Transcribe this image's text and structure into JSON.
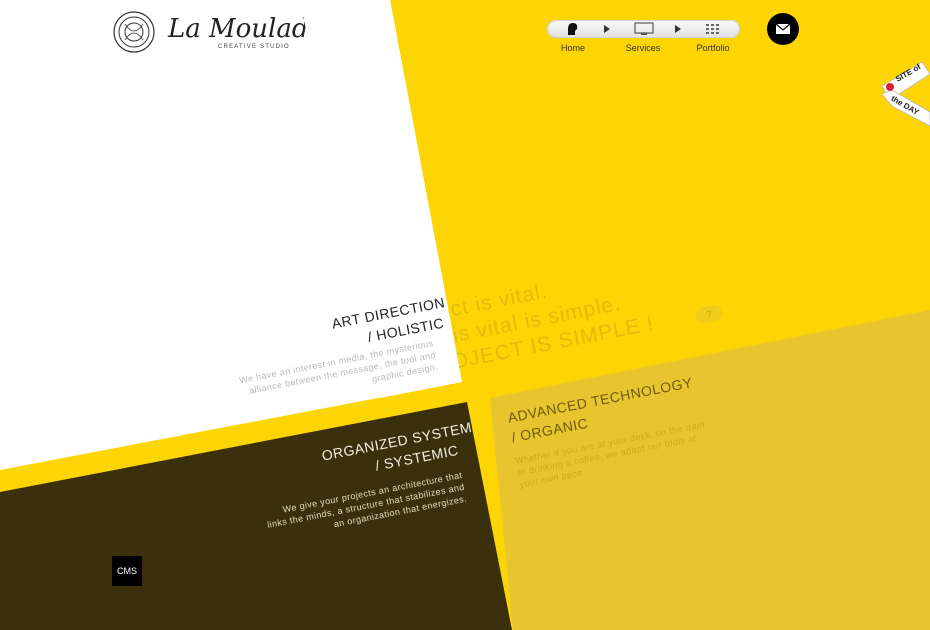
{
  "brand": {
    "name": "La Moulade",
    "subtitle": "CREATIVE STUDIO"
  },
  "nav": {
    "items": [
      {
        "label": "Home",
        "icon": "head-silhouette-icon"
      },
      {
        "label": "Services",
        "icon": "monitor-icon"
      },
      {
        "label": "Portfolio",
        "icon": "grid-icon"
      }
    ]
  },
  "contact": {
    "icon": "mail-icon"
  },
  "badge": {
    "line1": "SITE of",
    "line2": "the DAY"
  },
  "tagline": {
    "line1": "roject is vital.",
    "line2": "at is vital is simple.",
    "line3": "ROJECT IS SIMPLE !",
    "help": "?"
  },
  "sections": {
    "art": {
      "title1": "ART DIRECTION",
      "title2": "/ HOLISTIC",
      "desc": [
        "We have an interest in media, the mysterious",
        "alliance between the message, the tool and",
        "graphic design."
      ]
    },
    "system": {
      "title1": "ORGANIZED SYSTEM",
      "title2": "/ SYSTEMIC",
      "desc": [
        "We give your projects an architecture that",
        "links the minds, a structure that stabilizes and",
        "an organization that energizes."
      ]
    },
    "tech": {
      "title1": "ADVANCED TECHNOLOGY",
      "title2": "/ ORGANIC",
      "desc": [
        "Whether if you are at your desk, on the train",
        "or drinking a coffee, we adapt our tools at",
        "your own pace."
      ]
    }
  },
  "cms": {
    "label": "CMS"
  },
  "colors": {
    "yellow": "#fdd404",
    "mustard": "#e8c52f",
    "dark": "#3a310c",
    "white": "#ffffff"
  }
}
